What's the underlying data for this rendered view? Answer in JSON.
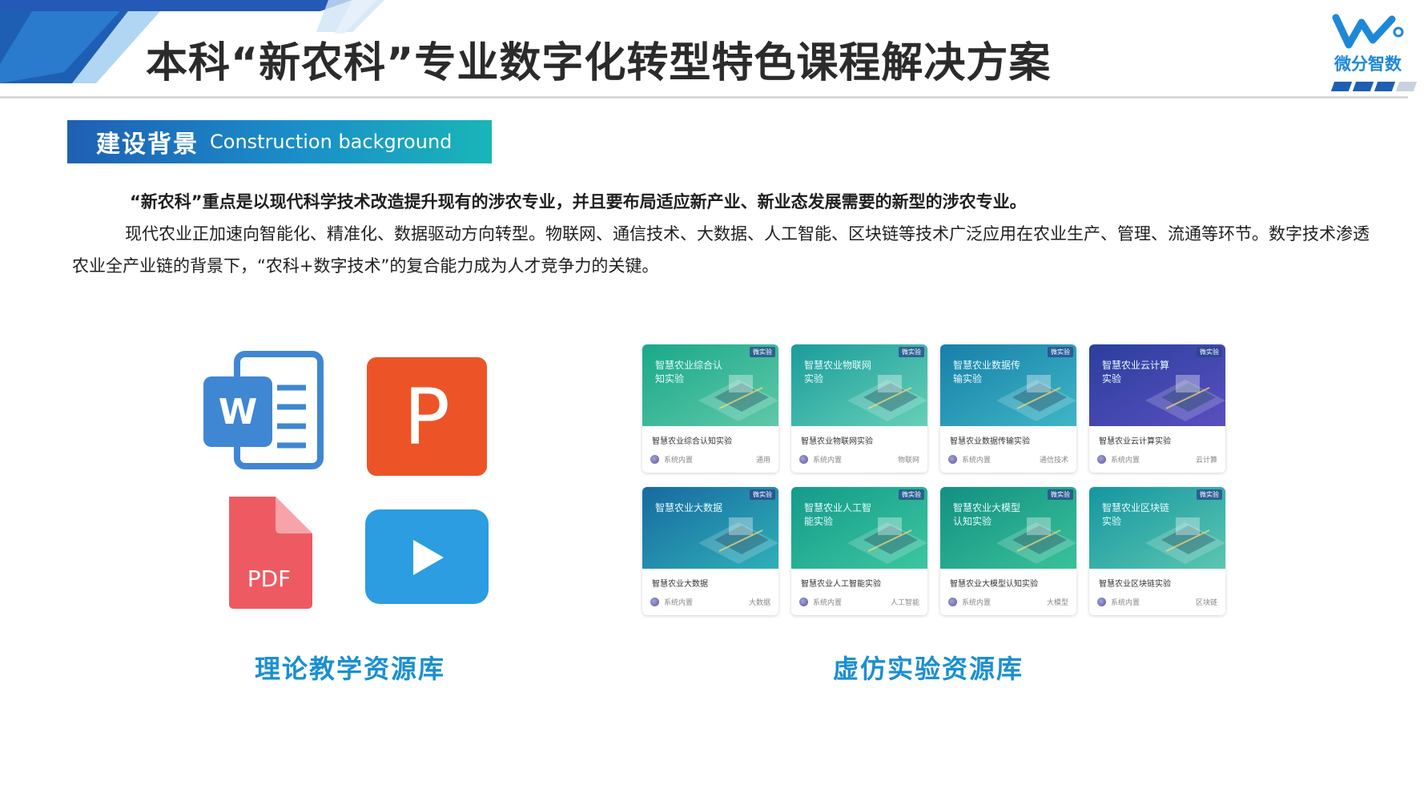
{
  "header": {
    "title": "本科“新农科”专业数字化转型特色课程解决方案",
    "logo_text": "微分智数",
    "colors": {
      "primary": "#1e5fb4",
      "accent": "#1b8fd0",
      "teal": "#19b5b8"
    }
  },
  "section": {
    "title_cn": "建设背景",
    "title_en": "Construction background"
  },
  "body": {
    "para1": "“新农科”重点是以现代科学技术改造提升现有的涉农专业，并且要布局适应新产业、新业态发展需要的新型的涉农专业。",
    "para2": "现代农业正加速向智能化、精准化、数据驱动方向转型。物联网、通信技术、大数据、人工智能、区块链等技术广泛应用在农业生产、管理、流通等环节。数字技术渗透农业全产业链的背景下，“农科+数字技术”的复合能力成为人才竞争力的关键。"
  },
  "theory": {
    "label": "理论教学资源库",
    "icons": [
      {
        "name": "word-icon",
        "glyph": "W"
      },
      {
        "name": "powerpoint-icon",
        "glyph": "P"
      },
      {
        "name": "pdf-icon",
        "glyph": "PDF"
      },
      {
        "name": "video-play-icon",
        "glyph": ""
      }
    ]
  },
  "virtual": {
    "label": "虚仿实验资源库",
    "badge": "微实验",
    "cards": [
      {
        "img_title": "智慧农业综合认知实验",
        "name": "智慧农业综合认知实验",
        "source": "系统内置",
        "tag": "通用",
        "bg1": "#1aa88a",
        "bg2": "#5fc9a8"
      },
      {
        "img_title": "智慧农业物联网实验",
        "name": "智慧农业物联网实验",
        "source": "系统内置",
        "tag": "物联网",
        "bg1": "#1a9c9a",
        "bg2": "#66d0b8"
      },
      {
        "img_title": "智慧农业数据传输实验",
        "name": "智慧农业数据传输实验",
        "source": "系统内置",
        "tag": "通信技术",
        "bg1": "#177fa8",
        "bg2": "#3fb6c6"
      },
      {
        "img_title": "智慧农业云计算实验",
        "name": "智慧农业云计算实验",
        "source": "系统内置",
        "tag": "云计算",
        "bg1": "#2a3f9c",
        "bg2": "#5a4fc0"
      },
      {
        "img_title": "智慧农业大数据",
        "name": "智慧农业大数据",
        "source": "系统内置",
        "tag": "大数据",
        "bg1": "#176aa0",
        "bg2": "#2fb0b8"
      },
      {
        "img_title": "智慧农业人工智能实验",
        "name": "智慧农业人工智能实验",
        "source": "系统内置",
        "tag": "人工智能",
        "bg1": "#159a8a",
        "bg2": "#3bc7a0"
      },
      {
        "img_title": "智慧农业大模型认知实验",
        "name": "智慧农业大模型认知实验",
        "source": "系统内置",
        "tag": "大模型",
        "bg1": "#138f82",
        "bg2": "#39c29a"
      },
      {
        "img_title": "智慧农业区块链实验",
        "name": "智慧农业区块链实验",
        "source": "系统内置",
        "tag": "区块链",
        "bg1": "#1596a0",
        "bg2": "#5cc6b0"
      }
    ]
  }
}
